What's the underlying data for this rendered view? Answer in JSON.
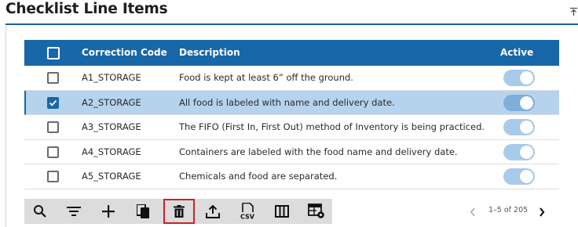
{
  "header": {
    "title": "Checklist Line Items"
  },
  "table": {
    "columns": {
      "code": "Correction Code",
      "description": "Description",
      "active": "Active"
    },
    "rows": [
      {
        "code": "A1_STORAGE",
        "description": "Food is kept at least 6” off the ground.",
        "checked": false,
        "active": true
      },
      {
        "code": "A2_STORAGE",
        "description": "All food is labeled with name and delivery date.",
        "checked": true,
        "active": true
      },
      {
        "code": "A3_STORAGE",
        "description": "The FIFO (First In, First Out) method of Inventory is being practiced.",
        "checked": false,
        "active": true
      },
      {
        "code": "A4_STORAGE",
        "description": "Containers are labeled with the food name and delivery date.",
        "checked": false,
        "active": true
      },
      {
        "code": "A5_STORAGE",
        "description": "Chemicals and food are separated.",
        "checked": false,
        "active": true
      }
    ]
  },
  "toolbar": {
    "icons": [
      "search-icon",
      "filter-icon",
      "add-icon",
      "copy-icon",
      "delete-icon",
      "export-icon",
      "csv-icon",
      "columns-icon",
      "settings-icon"
    ],
    "active_icon": "delete-icon"
  },
  "pagination": {
    "range_text": "1–5 of 205"
  },
  "colors": {
    "header_bg": "#1867a8",
    "selected_row": "#b6d3ee",
    "toggle_on": "#a9cbea",
    "toolbar_bg": "#dcdcdc",
    "active_outline": "#c4242b"
  }
}
